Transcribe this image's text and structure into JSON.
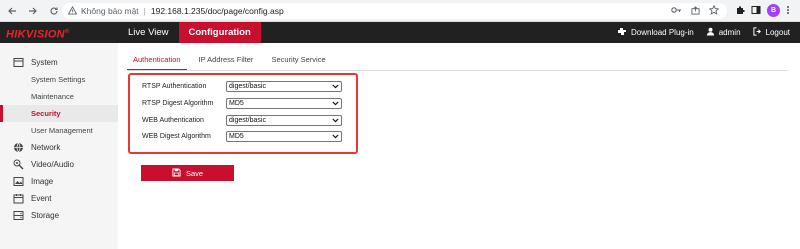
{
  "browser": {
    "security_label": "Không bảo mật",
    "url": "192.168.1.235/doc/page/config.asp",
    "profile_initial": "B"
  },
  "header": {
    "logo_text": "HIKVISION",
    "logo_mark": "®",
    "nav": [
      {
        "label": "Live View",
        "active": false
      },
      {
        "label": "Configuration",
        "active": true
      }
    ],
    "download_plugin": "Download Plug-in",
    "user": "admin",
    "logout": "Logout"
  },
  "sidebar": {
    "system": "System",
    "system_settings": "System Settings",
    "maintenance": "Maintenance",
    "security": "Security",
    "user_management": "User Management",
    "network": "Network",
    "video_audio": "Video/Audio",
    "image": "Image",
    "event": "Event",
    "storage": "Storage"
  },
  "tabs": {
    "authentication": "Authentication",
    "ip_address_filter": "IP Address Filter",
    "security_service": "Security Service"
  },
  "form": {
    "rows": [
      {
        "label": "RTSP Authentication",
        "value": "digest/basic"
      },
      {
        "label": "RTSP Digest Algorithm",
        "value": "MD5"
      },
      {
        "label": "WEB Authentication",
        "value": "digest/basic"
      },
      {
        "label": "WEB Digest Algorithm",
        "value": "MD5"
      }
    ],
    "save_label": "Save"
  },
  "colors": {
    "brand_red": "#c8102e",
    "highlight_border": "#e53935",
    "header_bg": "#212121"
  }
}
